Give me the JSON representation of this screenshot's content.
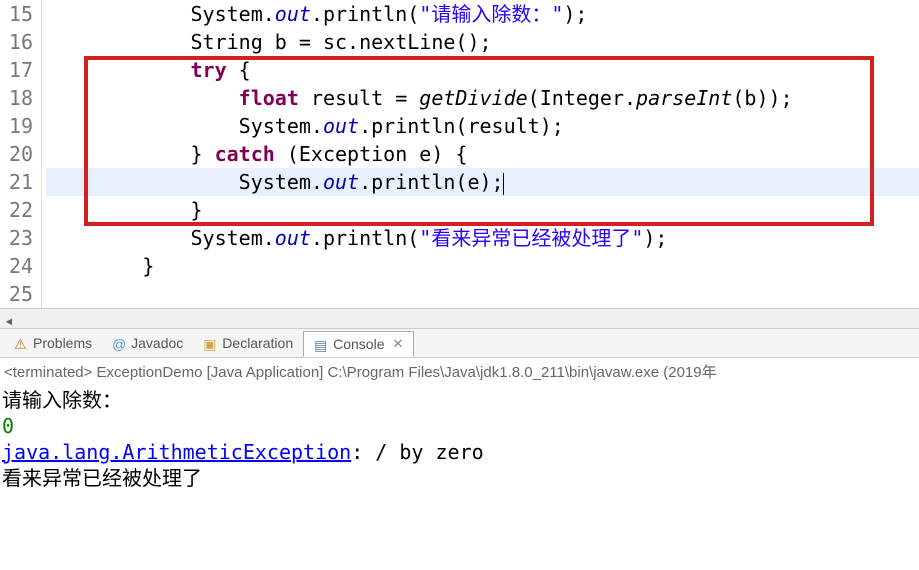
{
  "editor": {
    "line_start": 15,
    "lines": {
      "15": {
        "indent": "            ",
        "tokens": [
          "System",
          ".",
          "out",
          ".println(",
          "\"请输入除数：\"",
          ");"
        ]
      },
      "16": {
        "indent": "            ",
        "text": "String b = sc.nextLine();"
      },
      "17": {
        "indent": "            ",
        "text": "try {"
      },
      "18": {
        "indent": "                ",
        "tokens": [
          "float",
          " result = ",
          "getDivide",
          "(Integer.",
          "parseInt",
          "(b));"
        ]
      },
      "19": {
        "indent": "                ",
        "tokens": [
          "System",
          ".",
          "out",
          ".println(result);"
        ]
      },
      "20": {
        "indent": "            ",
        "tokens": [
          "} ",
          "catch",
          " (Exception e) {"
        ]
      },
      "21": {
        "indent": "                ",
        "tokens": [
          "System",
          ".",
          "out",
          ".println(e);"
        ]
      },
      "22": {
        "indent": "            ",
        "text": "}"
      },
      "23": {
        "indent": "            ",
        "tokens": [
          "System",
          ".",
          "out",
          ".println(",
          "\"看来异常已经被处理了\"",
          ");"
        ]
      },
      "24": {
        "indent": "        ",
        "text": "}"
      },
      "25": {
        "indent": "",
        "text": ""
      }
    }
  },
  "tabs": {
    "problems": "Problems",
    "javadoc": "Javadoc",
    "declaration": "Declaration",
    "console": "Console"
  },
  "console_header": "<terminated> ExceptionDemo [Java Application] C:\\Program Files\\Java\\jdk1.8.0_211\\bin\\javaw.exe (2019年",
  "console": {
    "line1": "请输入除数：",
    "line2": "0",
    "line3a": "java.lang.ArithmeticException",
    "line3b": ": / by zero",
    "line4": "看来异常已经被处理了"
  },
  "gutter_numbers": [
    "15",
    "16",
    "17",
    "18",
    "19",
    "20",
    "21",
    "22",
    "23",
    "24",
    "25"
  ]
}
